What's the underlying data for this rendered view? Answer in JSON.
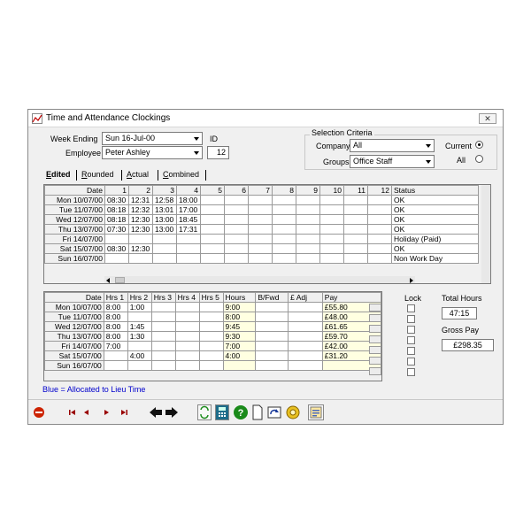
{
  "window": {
    "title": "Time and Attendance Clockings",
    "close_label": "✕"
  },
  "header": {
    "week_ending_label": "Week Ending",
    "week_ending_value": "Sun  16-Jul-00",
    "id_label": "ID",
    "employee_label": "Employee",
    "employee_value": "Peter Ashley",
    "id_value": "12"
  },
  "selection": {
    "title": "Selection Criteria",
    "company_label": "Company",
    "company_value": "All",
    "groups_label": "Groups",
    "groups_value": "Office Staff",
    "current_label": "Current",
    "all_label": "All",
    "current_selected": true
  },
  "tabs": [
    {
      "label": "Edited",
      "underline": "E",
      "rest": "dited",
      "active": true
    },
    {
      "label": "Rounded",
      "underline": "R",
      "rest": "ounded",
      "active": false
    },
    {
      "label": "Actual",
      "underline": "A",
      "rest": "ctual",
      "active": false
    },
    {
      "label": "Combined",
      "underline": "C",
      "rest": "ombined",
      "active": false
    }
  ],
  "clockings": {
    "headers": [
      "Date",
      "1",
      "2",
      "3",
      "4",
      "5",
      "6",
      "7",
      "8",
      "9",
      "10",
      "11",
      "12",
      "Status"
    ],
    "rows": [
      {
        "date": "Mon 10/07/00",
        "times": [
          "08:30",
          "12:31",
          "12:58",
          "18:00",
          "",
          "",
          "",
          "",
          "",
          "",
          "",
          ""
        ],
        "status": "OK"
      },
      {
        "date": "Tue 11/07/00",
        "times": [
          "08:18",
          "12:32",
          "13:01",
          "17:00",
          "",
          "",
          "",
          "",
          "",
          "",
          "",
          ""
        ],
        "status": "OK"
      },
      {
        "date": "Wed 12/07/00",
        "times": [
          "08:18",
          "12:30",
          "13:00",
          "18:45",
          "",
          "",
          "",
          "",
          "",
          "",
          "",
          ""
        ],
        "status": "OK"
      },
      {
        "date": "Thu 13/07/00",
        "times": [
          "07:30",
          "12:30",
          "13:00",
          "17:31",
          "",
          "",
          "",
          "",
          "",
          "",
          "",
          ""
        ],
        "status": "OK"
      },
      {
        "date": "Fri 14/07/00",
        "times": [
          "",
          "",
          "",
          "",
          "",
          "",
          "",
          "",
          "",
          "",
          "",
          ""
        ],
        "status": "Holiday (Paid)"
      },
      {
        "date": "Sat 15/07/00",
        "times": [
          "08:30",
          "12:30",
          "",
          "",
          "",
          "",
          "",
          "",
          "",
          "",
          "",
          ""
        ],
        "status": "OK"
      },
      {
        "date": "Sun 16/07/00",
        "times": [
          "",
          "",
          "",
          "",
          "",
          "",
          "",
          "",
          "",
          "",
          "",
          ""
        ],
        "status": "Non Work Day"
      }
    ]
  },
  "hours": {
    "headers": [
      "Date",
      "Hrs 1",
      "Hrs 2",
      "Hrs 3",
      "Hrs 4",
      "Hrs 5",
      "Hours",
      "B/Fwd",
      "£ Adj",
      "Pay"
    ],
    "rows": [
      {
        "date": "Mon 10/07/00",
        "hrs": [
          "8:00",
          "1:00",
          "",
          "",
          ""
        ],
        "hours": "9:00",
        "bfwd": "",
        "adj": "",
        "pay": "£55.80"
      },
      {
        "date": "Tue 11/07/00",
        "hrs": [
          "8:00",
          "",
          "",
          "",
          ""
        ],
        "hours": "8:00",
        "bfwd": "",
        "adj": "",
        "pay": "£48.00"
      },
      {
        "date": "Wed 12/07/00",
        "hrs": [
          "8:00",
          "1:45",
          "",
          "",
          ""
        ],
        "hours": "9:45",
        "bfwd": "",
        "adj": "",
        "pay": "£61.65"
      },
      {
        "date": "Thu 13/07/00",
        "hrs": [
          "8:00",
          "1:30",
          "",
          "",
          ""
        ],
        "hours": "9:30",
        "bfwd": "",
        "adj": "",
        "pay": "£59.70"
      },
      {
        "date": "Fri 14/07/00",
        "hrs": [
          "7:00",
          "",
          "",
          "",
          ""
        ],
        "hours": "7:00",
        "bfwd": "",
        "adj": "",
        "pay": "£42.00"
      },
      {
        "date": "Sat 15/07/00",
        "hrs": [
          "",
          "4:00",
          "",
          "",
          ""
        ],
        "hours": "4:00",
        "bfwd": "",
        "adj": "",
        "pay": "£31.20"
      },
      {
        "date": "Sun 16/07/00",
        "hrs": [
          "",
          "",
          "",
          "",
          ""
        ],
        "hours": "",
        "bfwd": "",
        "adj": "",
        "pay": ""
      }
    ]
  },
  "summary": {
    "lock_label": "Lock",
    "total_hours_label": "Total Hours",
    "total_hours_value": "47:15",
    "gross_pay_label": "Gross Pay",
    "gross_pay_value": "£298.35"
  },
  "legend_note": "Blue = Allocated to Lieu Time",
  "toolbar_icons": [
    "stop-icon",
    "first-record-icon",
    "previous-record-icon",
    "next-record-icon",
    "last-record-icon",
    "back-arrow-icon",
    "forward-arrow-icon",
    "recalculate-icon",
    "calculator-icon",
    "help-icon",
    "new-document-icon",
    "redo-icon",
    "settings-icon",
    "report-icon"
  ],
  "colors": {
    "yellow_cell": "#ffffe1",
    "note_blue": "#0000cc",
    "stop_red": "#cc2200"
  }
}
